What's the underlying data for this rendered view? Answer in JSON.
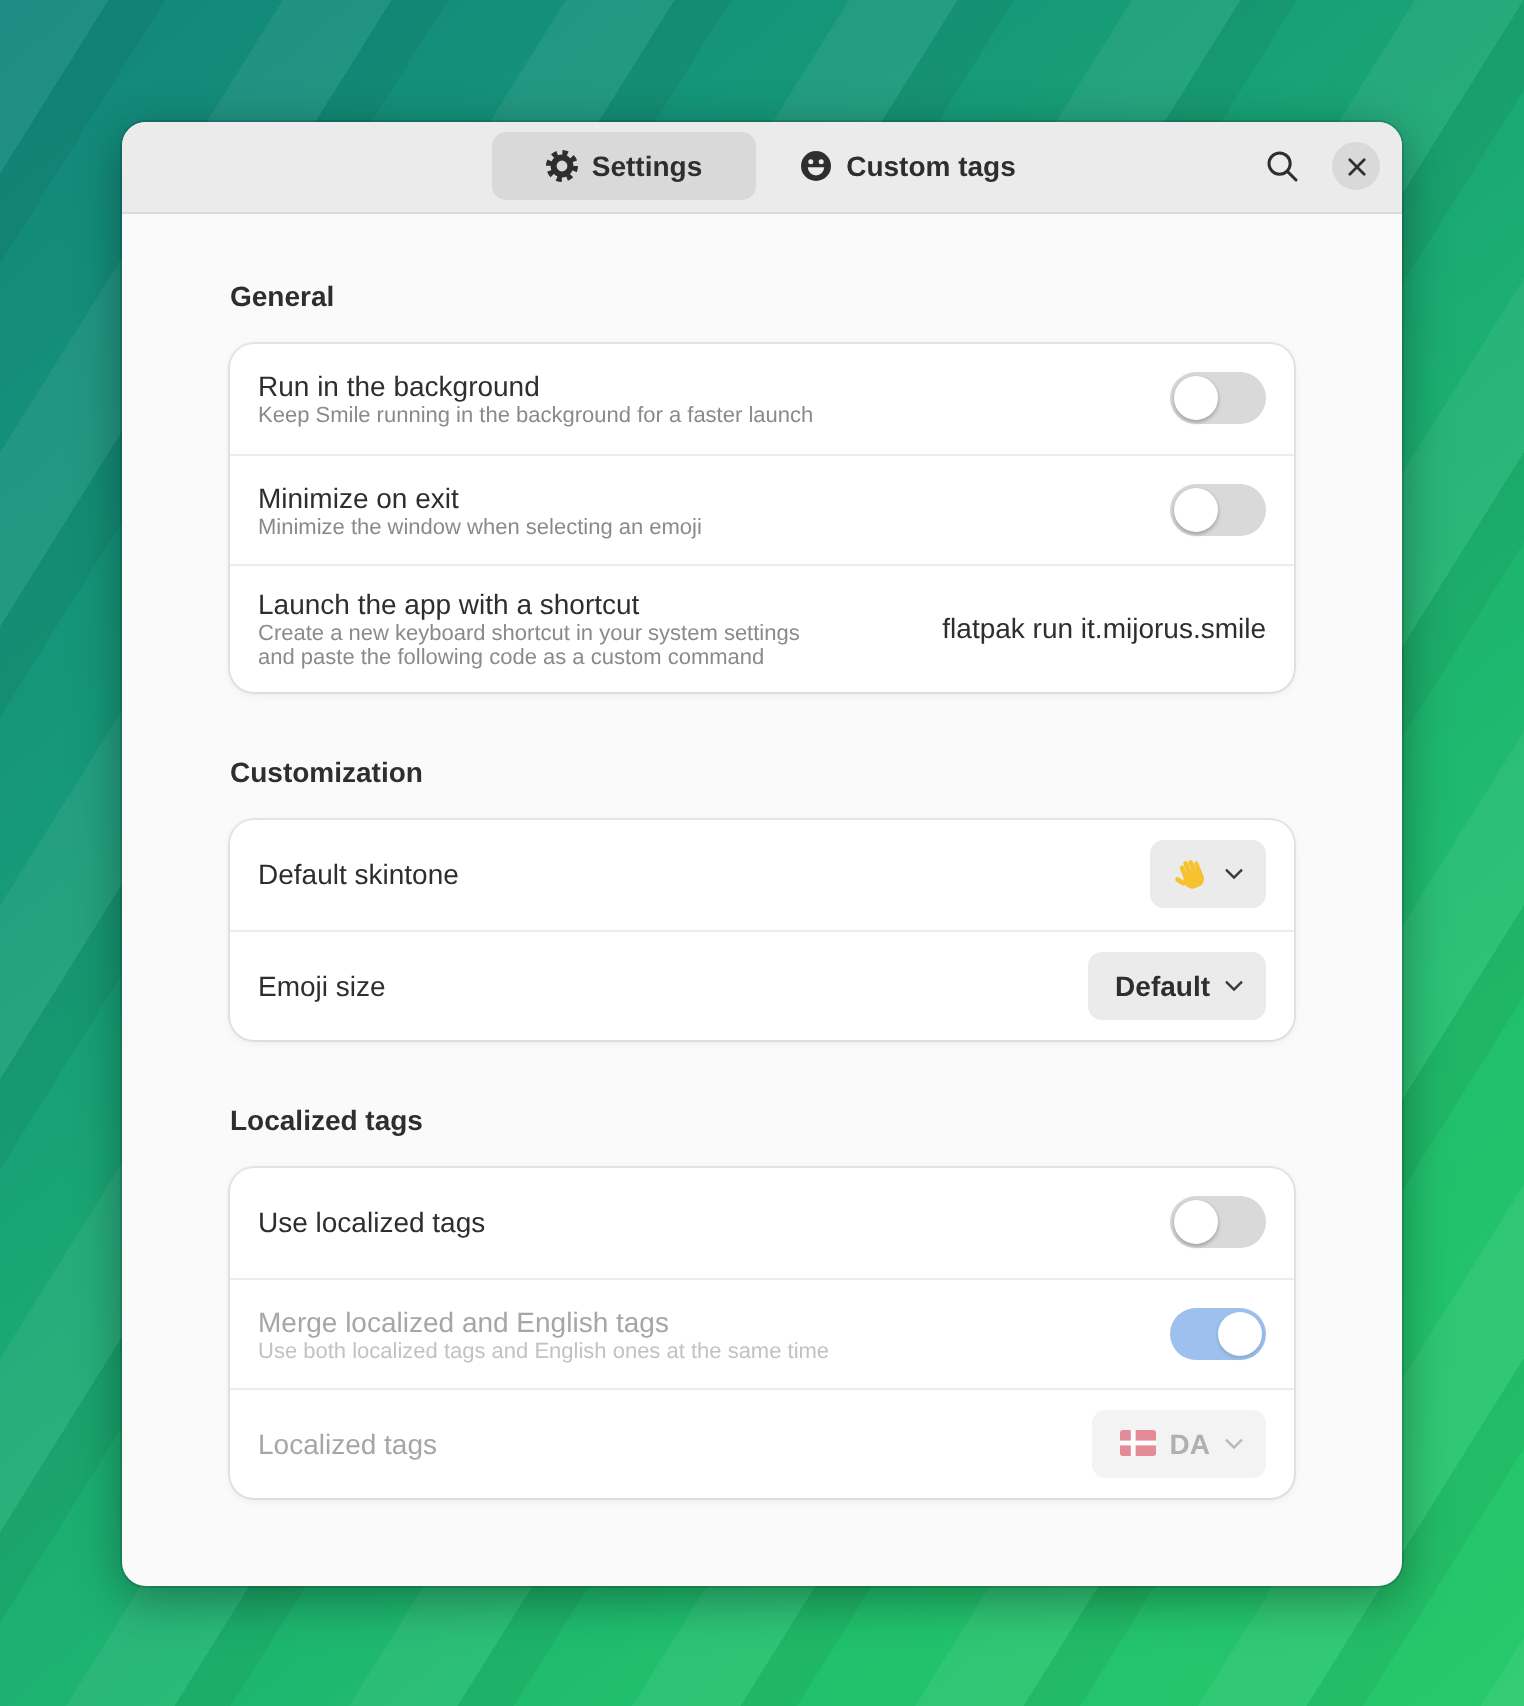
{
  "tabs": [
    {
      "label": "Settings",
      "selected": true
    },
    {
      "label": "Custom tags",
      "selected": false
    }
  ],
  "sections": [
    {
      "title": "General",
      "rows": [
        {
          "kind": "switch",
          "title": "Run in the background",
          "subtitle": "Keep Smile running in the background for a faster launch",
          "on": false,
          "disabled": false
        },
        {
          "kind": "switch",
          "title": "Minimize on exit",
          "subtitle": "Minimize the window when selecting an emoji",
          "on": false,
          "disabled": false
        },
        {
          "kind": "command",
          "title": "Launch the app with a shortcut",
          "subtitle": "Create a new keyboard shortcut in your system settings and paste the following code as a custom command",
          "value": "flatpak run it.mijorus.smile",
          "disabled": false
        }
      ]
    },
    {
      "title": "Customization",
      "rows": [
        {
          "kind": "emoji-select",
          "title": "Default skintone",
          "disabled": false
        },
        {
          "kind": "select",
          "title": "Emoji size",
          "value": "Default",
          "disabled": false
        }
      ]
    },
    {
      "title": "Localized tags",
      "rows": [
        {
          "kind": "switch",
          "title": "Use localized tags",
          "on": false,
          "disabled": false
        },
        {
          "kind": "switch",
          "title": "Merge localized and English tags",
          "subtitle": "Use both localized tags and English ones at the same time",
          "on": true,
          "disabled": true
        },
        {
          "kind": "flag-select",
          "title": "Localized tags",
          "value": "DA",
          "disabled": true
        }
      ]
    }
  ]
}
